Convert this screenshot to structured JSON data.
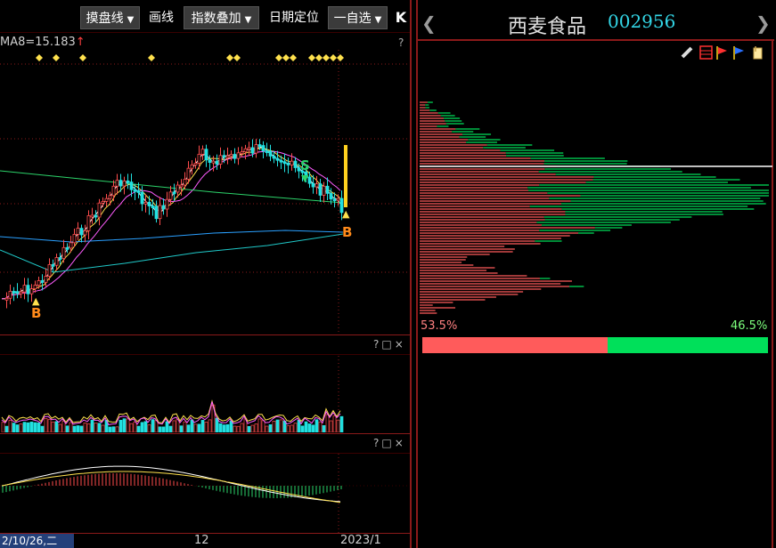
{
  "toolbar": {
    "template_label": "摸盘线",
    "draw_label": "画线",
    "overlay_label": "指数叠加",
    "date_locate_label": "日期定位",
    "watchlist_label": "一自选",
    "collapse_label": "K"
  },
  "main_chart": {
    "ma_text": "MA8=15.183",
    "signal_buy": "B",
    "signal_sell": "S",
    "help_mark": "?"
  },
  "sub_panel": {
    "controls": "?□×"
  },
  "axis": {
    "date_start": "2/10/26,二",
    "mid_label": "12",
    "end_label": "2023/1"
  },
  "stock": {
    "name": "西麦食品",
    "code": "002956",
    "prev_icon": "chevron-left-icon",
    "next_icon": "chevron-right-icon"
  },
  "tools": [
    "pencil-icon",
    "grid-icon",
    "flag-red-icon",
    "flag-blue-icon",
    "clip-icon"
  ],
  "distribution": {
    "profit_pct": "53.5%",
    "loss_pct": "46.5%",
    "profit_ratio": 0.535,
    "profit_color": "#ff5b5b",
    "loss_color": "#00e05a"
  },
  "colors": {
    "frame": "#8b1a1a",
    "up": "#ff4d4d",
    "down": "#21e0e0",
    "ma_white": "#ffffff",
    "ma_yellow": "#ffe14d",
    "ma_magenta": "#ff5cff",
    "ma_green": "#2cd36a",
    "ma_blue": "#2aa0ff"
  }
}
